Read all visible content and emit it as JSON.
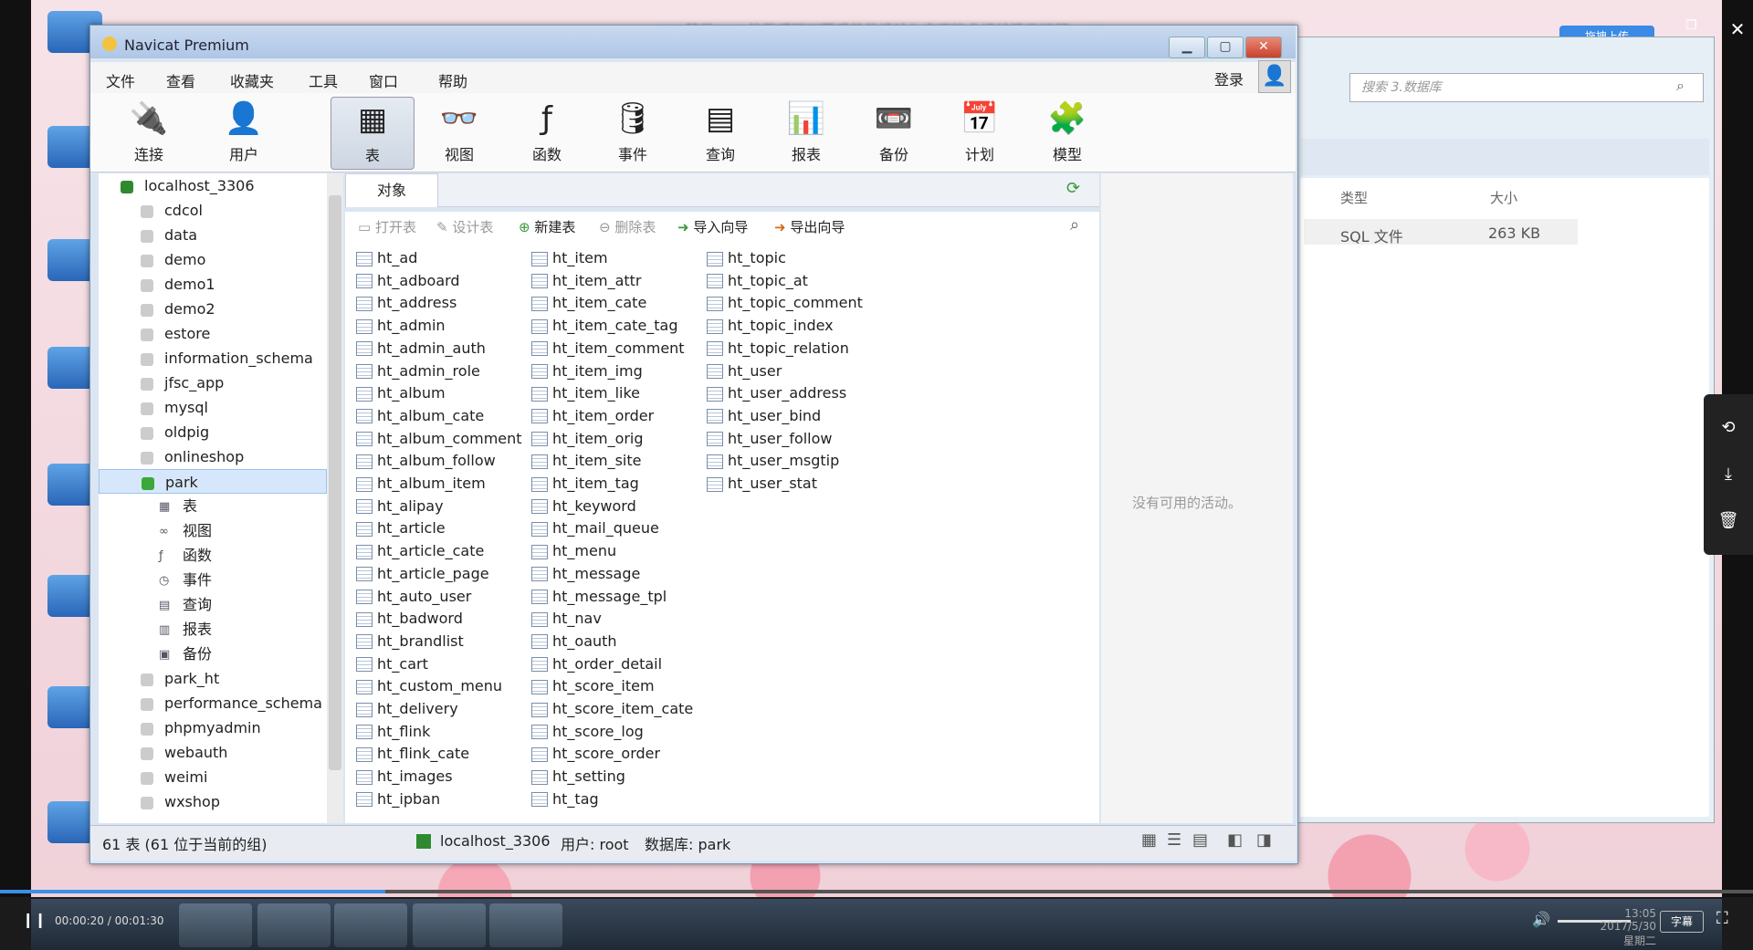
{
  "video": {
    "title": "033基于PHP的游乐园订票系统的设计与实现毕业设计演示视频.avi",
    "upload_label": "拖拽上传",
    "current_time": "00:00:20 / 00:01:30",
    "subtitle_label": "字幕",
    "progress": 0.22,
    "clock_time": "13:05",
    "clock_date": "2017/5/30 星期二"
  },
  "window": {
    "title": "Navicat Premium",
    "login_label": "登录"
  },
  "menu": [
    "文件",
    "查看",
    "收藏夹",
    "工具",
    "窗口",
    "帮助"
  ],
  "toolbar": [
    {
      "label": "连接",
      "icon": "plug-icon"
    },
    {
      "label": "用户",
      "icon": "user-icon"
    },
    {
      "label": "表",
      "icon": "table-icon"
    },
    {
      "label": "视图",
      "icon": "view-icon"
    },
    {
      "label": "函数",
      "icon": "function-icon"
    },
    {
      "label": "事件",
      "icon": "event-icon"
    },
    {
      "label": "查询",
      "icon": "query-icon"
    },
    {
      "label": "报表",
      "icon": "report-icon"
    },
    {
      "label": "备份",
      "icon": "backup-icon"
    },
    {
      "label": "计划",
      "icon": "schedule-icon"
    },
    {
      "label": "模型",
      "icon": "model-icon"
    }
  ],
  "tree": {
    "connection": "localhost_3306",
    "databases_before": [
      "cdcol",
      "data",
      "demo",
      "demo1",
      "demo2",
      "estore",
      "information_schema",
      "jfsc_app",
      "mysql",
      "oldpig",
      "onlineshop"
    ],
    "selected_db": "park",
    "selected_children": [
      "表",
      "视图",
      "函数",
      "事件",
      "查询",
      "报表",
      "备份"
    ],
    "databases_after": [
      "park_ht",
      "performance_schema",
      "phpmyadmin",
      "webauth",
      "weimi",
      "wxshop"
    ]
  },
  "objects": {
    "tab_label": "对象",
    "actions": [
      "打开表",
      "设计表",
      "新建表",
      "删除表",
      "导入向导",
      "导出向导"
    ],
    "column1": [
      "ht_ad",
      "ht_adboard",
      "ht_address",
      "ht_admin",
      "ht_admin_auth",
      "ht_admin_role",
      "ht_album",
      "ht_album_cate",
      "ht_album_comment",
      "ht_album_follow",
      "ht_album_item",
      "ht_alipay",
      "ht_article",
      "ht_article_cate",
      "ht_article_page",
      "ht_auto_user",
      "ht_badword",
      "ht_brandlist",
      "ht_cart",
      "ht_custom_menu",
      "ht_delivery",
      "ht_flink",
      "ht_flink_cate",
      "ht_images",
      "ht_ipban"
    ],
    "column2": [
      "ht_item",
      "ht_item_attr",
      "ht_item_cate",
      "ht_item_cate_tag",
      "ht_item_comment",
      "ht_item_img",
      "ht_item_like",
      "ht_item_order",
      "ht_item_orig",
      "ht_item_site",
      "ht_item_tag",
      "ht_keyword",
      "ht_mail_queue",
      "ht_menu",
      "ht_message",
      "ht_message_tpl",
      "ht_nav",
      "ht_oauth",
      "ht_order_detail",
      "ht_score_item",
      "ht_score_item_cate",
      "ht_score_log",
      "ht_score_order",
      "ht_setting",
      "ht_tag"
    ],
    "column3": [
      "ht_topic",
      "ht_topic_at",
      "ht_topic_comment",
      "ht_topic_index",
      "ht_topic_relation",
      "ht_user",
      "ht_user_address",
      "ht_user_bind",
      "ht_user_follow",
      "ht_user_msgtip",
      "ht_user_stat"
    ],
    "no_activity": "没有可用的活动。"
  },
  "status": {
    "count": "61 表 (61 位于当前的组)",
    "connection": "localhost_3306",
    "user": "用户: root",
    "database": "数据库: park"
  },
  "explorer": {
    "search_placeholder": "搜索 3.数据库",
    "col_type": "类型",
    "col_size": "大小",
    "file_type": "SQL 文件",
    "file_size": "263 KB"
  }
}
